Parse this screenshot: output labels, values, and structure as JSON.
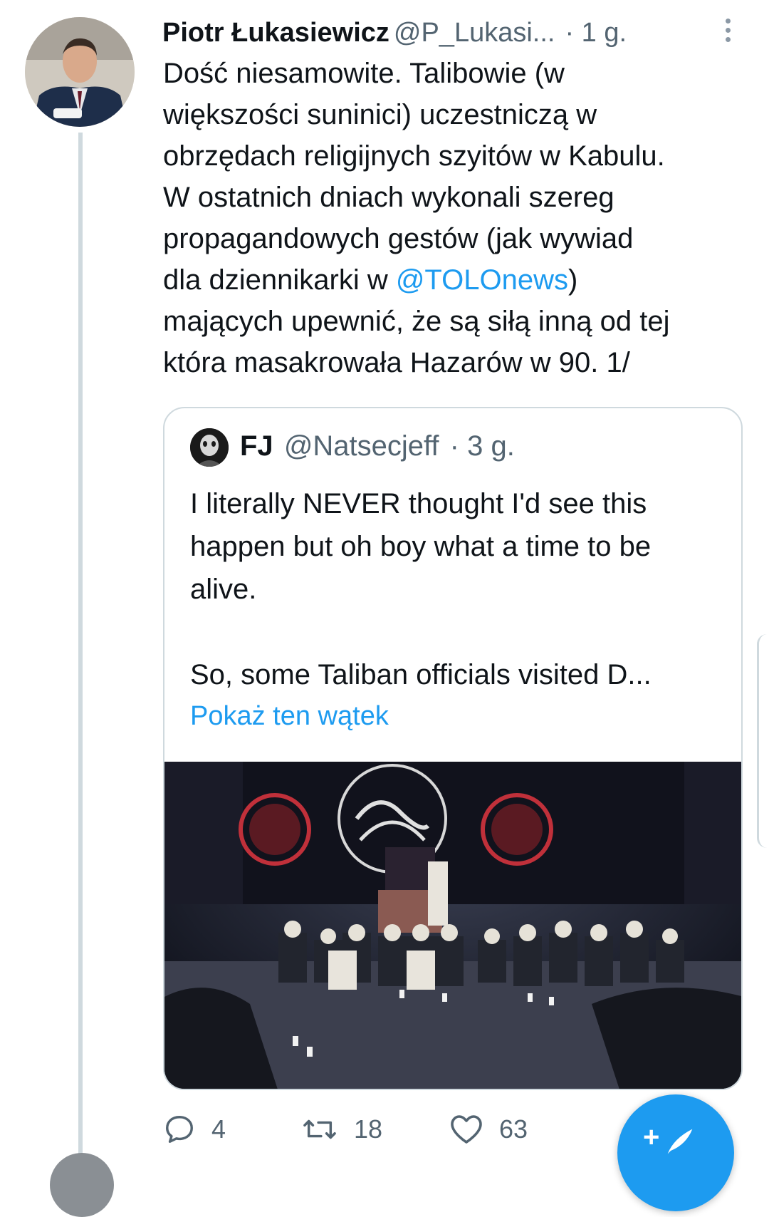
{
  "tweet": {
    "author_name": "Piotr Łukasiewicz",
    "author_handle": "@P_Lukasi...",
    "time": "· 1 g.",
    "text_before_mention": "Dość niesamowite. Talibowie (w\nwiększości suninici) uczestniczą w\nobrzędach religijnych szyitów w Kabulu.\nW ostatnich dniach wykonali szereg\npropagandowych gestów (jak wywiad\ndla dziennikarki w ",
    "mention": "@TOLOnews",
    "text_after_mention": ")\nmających upewnić, że są siłą inną od tej\nktóra masakrowała Hazarów w 90. 1/"
  },
  "quote": {
    "author_name": "FJ",
    "author_handle": "@Natsecjeff",
    "time": "· 3 g.",
    "text_line1": "I literally NEVER thought I'd see this happen but oh boy what a time to be alive.",
    "text_line2": "So, some Taliban officials visited D...",
    "show_thread": "Pokaż ten wątek"
  },
  "actions": {
    "reply_count": "4",
    "retweet_count": "18",
    "like_count": "63"
  },
  "icons": {
    "reply": "reply-icon",
    "retweet": "retweet-icon",
    "like": "heart-icon",
    "compose": "compose-tweet-icon",
    "more": "more-vertical-icon"
  },
  "colors": {
    "accent": "#1d9bf0",
    "text": "#0f1419",
    "secondary": "#536471",
    "border": "#cfd9de"
  }
}
